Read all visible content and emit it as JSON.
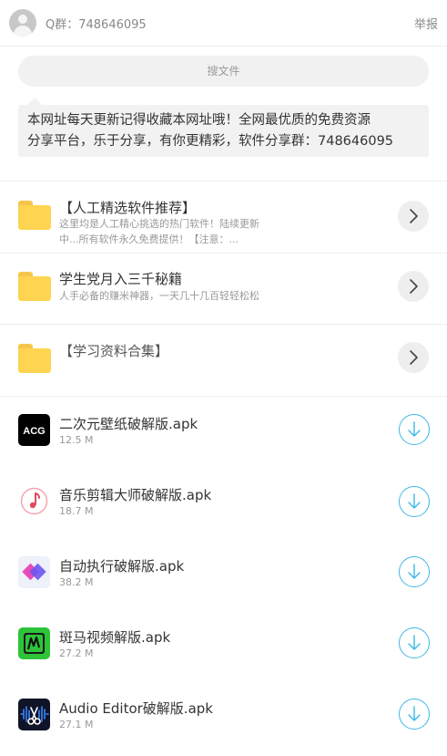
{
  "header": {
    "group_text": "Q群：748646095",
    "report_label": "举报"
  },
  "search": {
    "placeholder": "搜文件"
  },
  "notice": {
    "line1": "本网址每天更新记得收藏本网址哦！全网最优质的免费资源",
    "line2": "分享平台，乐于分享，有你更精彩，软件分享群：748646095"
  },
  "folders": [
    {
      "title": "【人工精选软件推荐】",
      "desc_line1": "这里均是人工精心挑选的热门软件！陆续更新",
      "desc_line2": "中...所有软件永久免费提供！【注意：..."
    },
    {
      "title": "学生党月入三千秘籍",
      "desc_line1": "人手必备的赚米神器，一天几十几百轻轻松松"
    },
    {
      "title": "【学习资料合集】"
    }
  ],
  "files": [
    {
      "name": "二次元壁纸破解版.apk",
      "size": "12.5 M",
      "icon": "acg-app-icon",
      "icon_text": "ACG"
    },
    {
      "name": "音乐剪辑大师破解版.apk",
      "size": "18.7 M",
      "icon": "music-note-app-icon"
    },
    {
      "name": "自动执行破解版.apk",
      "size": "38.2 M",
      "icon": "diamond-app-icon"
    },
    {
      "name": "斑马视频解版.apk",
      "size": "27.2 M",
      "icon": "zebra-video-app-icon"
    },
    {
      "name": "Audio Editor破解版.apk",
      "size": "27.1 M",
      "icon": "audio-editor-app-icon"
    }
  ],
  "colors": {
    "accent": "#3cb8e6",
    "folder": "#ffd451",
    "notice_bg": "#f2f2f2"
  }
}
